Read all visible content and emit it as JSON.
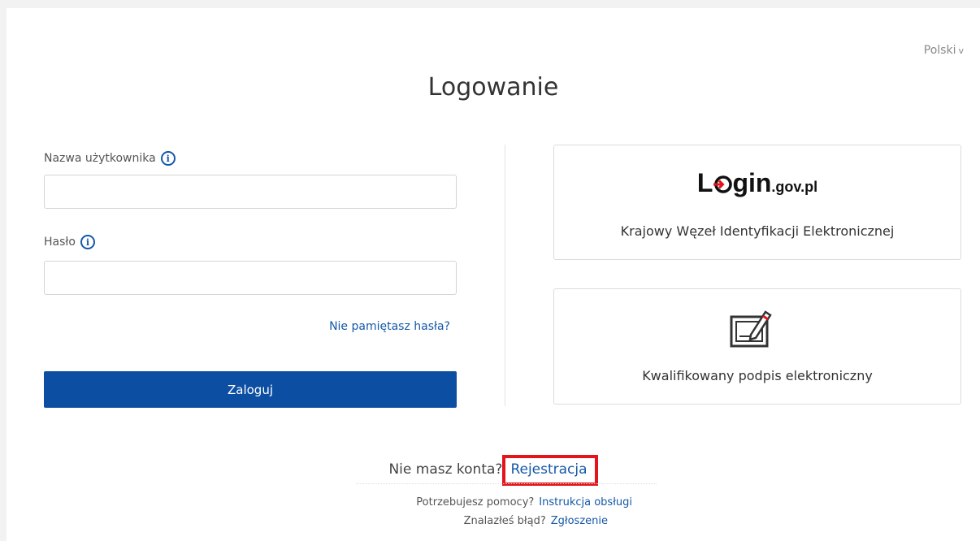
{
  "language": {
    "label": "Polski",
    "chevron": "v"
  },
  "title": "Logowanie",
  "form": {
    "username_label": "Nazwa użytkownika",
    "username_value": "",
    "password_label": "Hasło",
    "password_value": "",
    "info_glyph": "i",
    "forgot_password": "Nie pamiętasz hasła?",
    "login_button": "Zaloguj"
  },
  "options": {
    "login_gov": {
      "logo_main": "Login",
      "logo_suffix": ".gov.pl",
      "description": "Krajowy Węzeł Identyfikacji Elektronicznej"
    },
    "qualified_signature": {
      "description": "Kwalifikowany podpis elektroniczny",
      "icon": "signature-tablet-icon"
    }
  },
  "register": {
    "question": "Nie masz konta?",
    "link": "Rejestracja"
  },
  "help": {
    "need_help": "Potrzebujesz pomocy?",
    "manual_link": "Instrukcja obsługi",
    "found_bug": "Znalazłeś błąd?",
    "report_link": "Zgłoszenie"
  },
  "colors": {
    "primary": "#0c4ea2",
    "link": "#1558a8",
    "highlight": "#e3141b",
    "logo_accent": "#e3141b"
  }
}
